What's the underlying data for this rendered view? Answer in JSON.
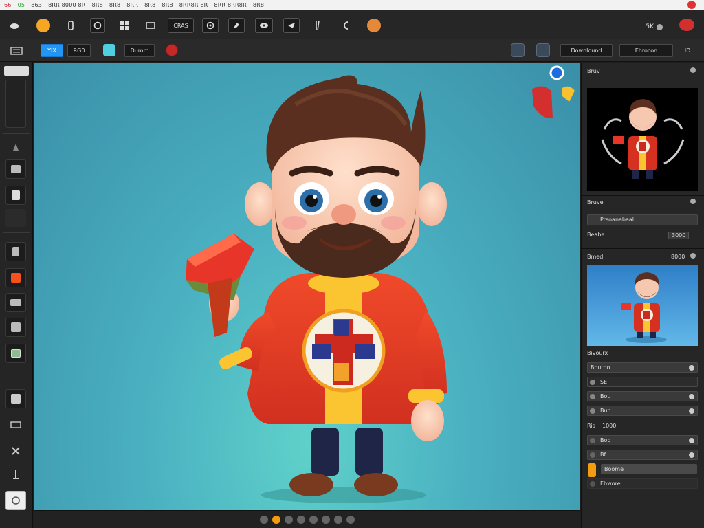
{
  "menubar": {
    "items": [
      "66",
      "05",
      "863",
      "8RR 8000 8R",
      "8R8",
      "8R8",
      "8RR",
      "8R8",
      "8R8",
      "8RR8R 8R",
      "8RR 8RR8R",
      "8R8"
    ]
  },
  "toolbar": {
    "compare_label": "CRAS",
    "zoom_label": "5K"
  },
  "options": {
    "mode_label": "YIX",
    "size_label": "RG0",
    "preset_label": "Dumm",
    "download_label": "Downlound",
    "export_label": "Ehrocon",
    "extra_label": "ID"
  },
  "panel": {
    "navigator_title": "Bruv",
    "layers_title": "Bruve",
    "opacity_label": "Prsoanabaal",
    "blend_label": "Beabe",
    "blend_value": "3000",
    "history_title": "Bmed",
    "history_value": "8000",
    "adjust_title": "Bivourx",
    "rows": [
      {
        "label": "Boutoo"
      },
      {
        "label": "SE"
      },
      {
        "label": "Bou"
      },
      {
        "label": "Bun"
      }
    ],
    "rows2_title": "Ris",
    "rows2_value": "1000",
    "rows2": [
      {
        "label": "Bob"
      },
      {
        "label": "Bf"
      },
      {
        "label": "Boome"
      },
      {
        "label": "Ebwore"
      }
    ]
  },
  "colors": {
    "accent": "#2196f3",
    "canvas_bg": "#4bb2c2",
    "sweater": "#e53935",
    "stripe": "#fdd835"
  }
}
